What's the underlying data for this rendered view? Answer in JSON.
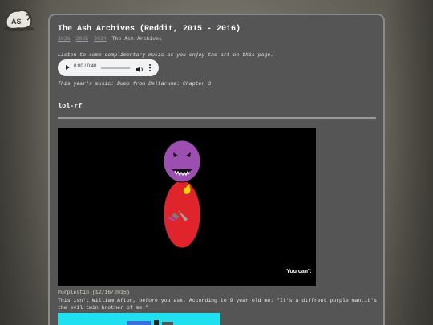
{
  "logo": {
    "icon": "ash-logo-icon"
  },
  "header": {
    "title": "The Ash Archives (Reddit, 2015 - 2016)",
    "nav_links": [
      "2026",
      "2025",
      "2024"
    ],
    "nav_current": "The Ash Archives"
  },
  "audio": {
    "intro": "Listen to some complimentary music as you enjoy the art on this page.",
    "time": "0:00 / 0:40",
    "progress": 0.0,
    "music_label": "This year's music: Dump from Deltarune: Chapter 3"
  },
  "section": {
    "heading": "lol-rf"
  },
  "artwork": {
    "caption": "You can't",
    "colors": {
      "background": "#000000",
      "head": "#9c4fb0",
      "body": "#e0242b",
      "flame": "#ffd200"
    }
  },
  "entry": {
    "link": "Purplestin (12/16/2015)",
    "text": "This isn't William Afton, before you ask. According to 9 year old me: \"It's a diffrent purple man,it's the evil twin brother of me.\""
  },
  "thumbnail": {
    "color": "#1ee0ee"
  }
}
